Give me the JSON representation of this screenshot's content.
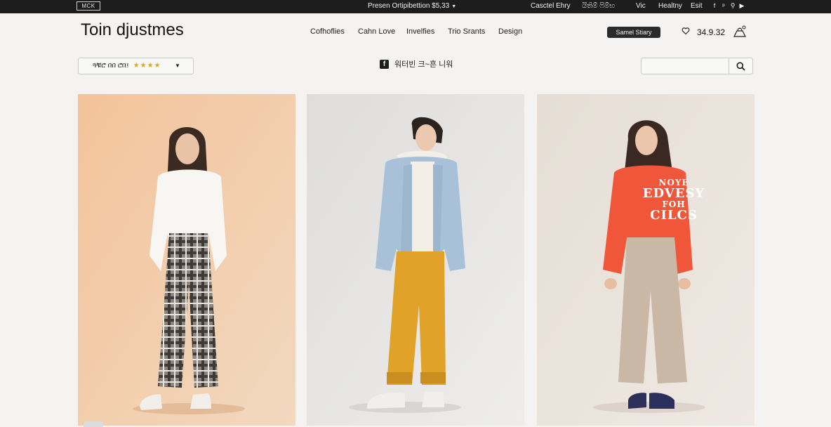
{
  "topbar": {
    "logo": "MCK",
    "promo": "Presen Ortipibettion $5,33",
    "links": [
      "Casctel Ehry",
      "යිතිම් ෆිම්භ",
      "Vic",
      "Healtny",
      "Esit"
    ],
    "social_icons": [
      "facebook-icon",
      "pinterest-icon",
      "location-icon",
      "youtube-icon"
    ]
  },
  "header": {
    "brand": "Toin djustmes",
    "nav": [
      "Cofhoflies",
      "Cahn Love",
      "Invelfies",
      "Trio Srants",
      "Design"
    ],
    "store_button": "Samel Stiary",
    "cart_total": "34.9.32"
  },
  "filters": {
    "sort_label": "ጓቹሮ በበ ሮበ፤",
    "sort_stars": "★★★★",
    "social_label": "워터빈 크~흔 니워",
    "search_placeholder": ""
  },
  "products": [
    {
      "name": "plaid-pants-look",
      "background": "#f1c9a2"
    },
    {
      "name": "denim-jacket-look",
      "background": "#e5e4e2"
    },
    {
      "name": "red-sweatshirt-look",
      "background": "#eae3dc",
      "print_lines": [
        "NOYE",
        "EDVESY",
        "FOH",
        "CILCS"
      ]
    }
  ],
  "colors": {
    "topbar": "#1d1d1d",
    "page_bg": "#f4f3f1",
    "star": "#e0a526"
  }
}
